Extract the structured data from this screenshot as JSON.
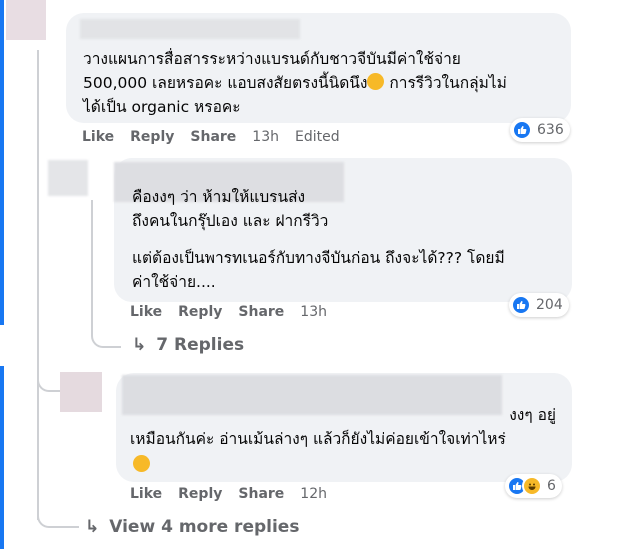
{
  "comments": [
    {
      "text_before_emoji": "วางแผนการสื่อสารระหว่างแบรนด์กับชาวจีบันมีค่าใช้จ่าย\n500,000 เลยหรอคะ แอบสงสัยตรงนี้นิดนึง",
      "text_after_emoji": " การรีวิวในกลุ่มไม่\nได้เป็น organic หรอคะ",
      "actions": {
        "like": "Like",
        "reply": "Reply",
        "share": "Share",
        "time": "13h",
        "edited": "Edited"
      },
      "reactions": {
        "count": "636",
        "icons": [
          "like-icon"
        ]
      }
    },
    {
      "text_line1": "คืองงๆ ว่า ห้ามให้แบรนส่ง\nถึงคนในกรุ๊ปเอง และ ฝากรีวิว",
      "text_line2": "แต่ต้องเป็นพารทเนอร์กับทางจีบันก่อน ถึงจะได้??? โดยมี\nค่าใช้จ่าย....",
      "actions": {
        "like": "Like",
        "reply": "Reply",
        "share": "Share",
        "time": "13h"
      },
      "reactions": {
        "count": "204",
        "icons": [
          "like-icon"
        ]
      },
      "replies_label": "7 Replies"
    },
    {
      "text_line1": "งงๆ อยู่",
      "text_line2": "เหมือนกันค่ะ อ่านเม้นล่างๆ แล้วก็ยังไม่ค่อยเข้าใจเท่าไหร่",
      "actions": {
        "like": "Like",
        "reply": "Reply",
        "share": "Share",
        "time": "12h"
      },
      "reactions": {
        "count": "6",
        "icons": [
          "like-icon",
          "haha-icon"
        ]
      }
    }
  ],
  "more_replies_label": "View 4 more replies",
  "colors": {
    "accent": "#1877f2",
    "bubble": "#f0f2f5",
    "meta": "#65676b"
  }
}
